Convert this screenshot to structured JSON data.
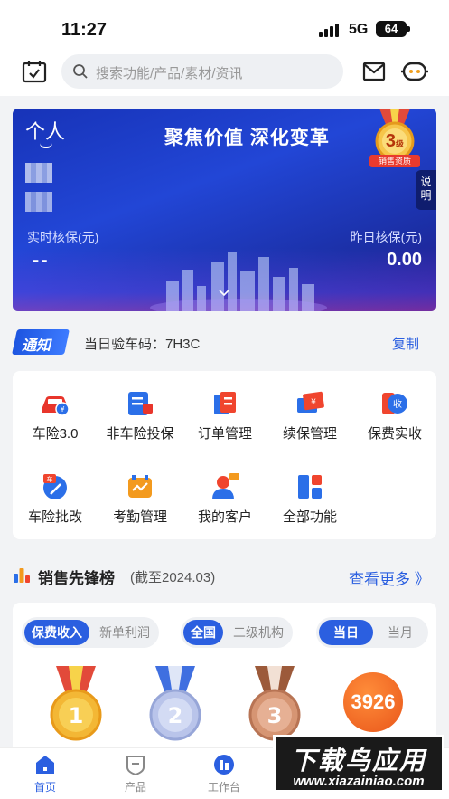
{
  "status_bar": {
    "time": "11:27",
    "network": "5G",
    "battery": "64"
  },
  "header": {
    "search_placeholder": "搜索功能/产品/素材/资讯"
  },
  "banner": {
    "person": "个人",
    "slogan": "聚焦价值 深化变革",
    "level_number": "3",
    "level_unit": "级",
    "level_caption": "销售资质",
    "explain": "说明",
    "realtime_label": "实时核保(元)",
    "realtime_value": "--",
    "yesterday_label": "昨日核保(元)",
    "yesterday_value": "0.00"
  },
  "notice": {
    "tag": "通知",
    "text": "当日验车码：7H3C",
    "copy": "复制"
  },
  "functions": [
    {
      "label": "车险3.0",
      "icon": "car-insurance-icon"
    },
    {
      "label": "非车险投保",
      "icon": "non-car-insurance-icon"
    },
    {
      "label": "订单管理",
      "icon": "order-icon"
    },
    {
      "label": "续保管理",
      "icon": "renewal-icon"
    },
    {
      "label": "保费实收",
      "icon": "premium-icon"
    },
    {
      "label": "车险批改",
      "icon": "car-endorsement-icon"
    },
    {
      "label": "考勤管理",
      "icon": "attendance-icon"
    },
    {
      "label": "我的客户",
      "icon": "customer-icon"
    },
    {
      "label": "全部功能",
      "icon": "all-functions-icon"
    }
  ],
  "ranking": {
    "title": "销售先锋榜",
    "subtitle": "(截至2024.03)",
    "more": "查看更多 》",
    "seg1": [
      "保费收入",
      "新单利润"
    ],
    "seg2": [
      "全国",
      "二级机构"
    ],
    "seg3": [
      "当日",
      "当月"
    ],
    "medals": [
      "1",
      "2",
      "3"
    ],
    "fourth": "3926"
  },
  "tabs": [
    "首页",
    "产品",
    "工作台"
  ],
  "watermark": {
    "title": "下载鸟应用",
    "url": "www.xiazainiao.com"
  },
  "colors": {
    "accent": "#2b5fe0",
    "banner": "#1f3cc4",
    "badge_orange": "#e9561a"
  }
}
